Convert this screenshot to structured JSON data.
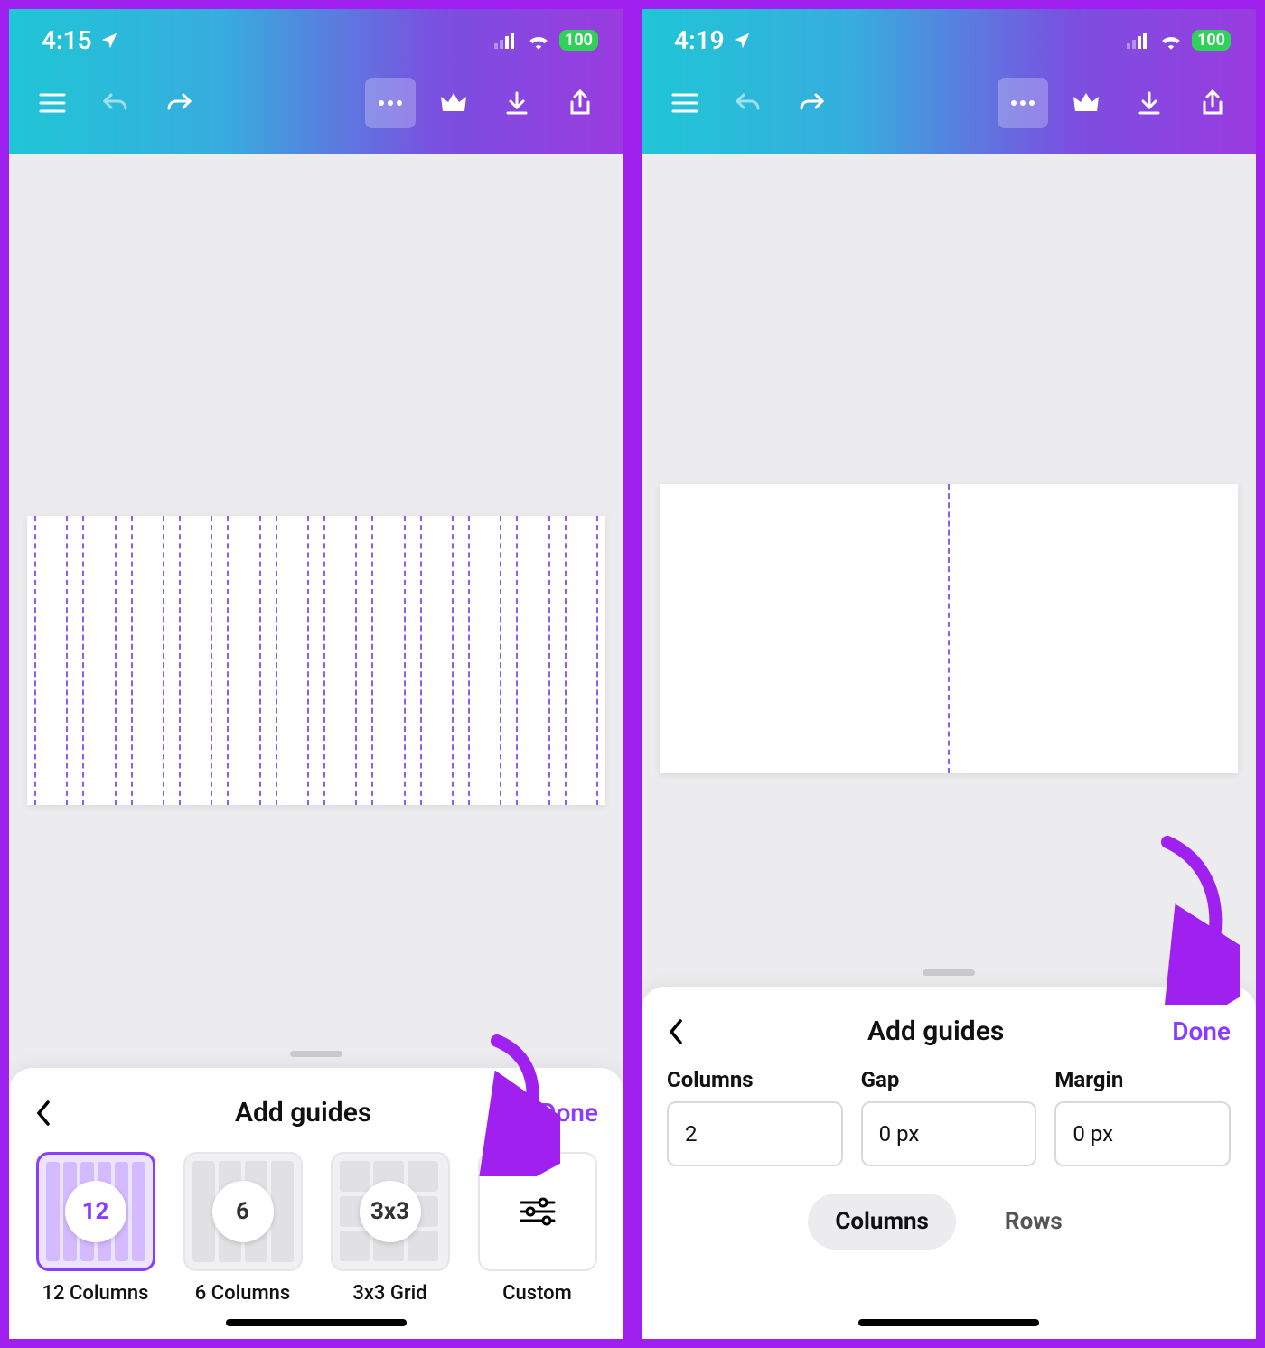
{
  "left": {
    "status": {
      "time": "4:15",
      "battery": "100"
    },
    "sheet": {
      "title": "Add guides",
      "done": "Done",
      "tiles": [
        {
          "badge": "12",
          "label": "12 Columns",
          "selected": true,
          "kind": "cols6"
        },
        {
          "badge": "6",
          "label": "6 Columns",
          "selected": false,
          "kind": "cols4"
        },
        {
          "badge": "3x3",
          "label": "3x3 Grid",
          "selected": false,
          "kind": "grid"
        },
        {
          "badge": "",
          "label": "Custom",
          "selected": false,
          "kind": "custom"
        }
      ]
    },
    "canvas": {
      "columns": 12
    }
  },
  "right": {
    "status": {
      "time": "4:19",
      "battery": "100"
    },
    "sheet": {
      "title": "Add guides",
      "done": "Done",
      "fields": {
        "columns": {
          "label": "Columns",
          "value": "2"
        },
        "gap": {
          "label": "Gap",
          "value": "0 px"
        },
        "margin": {
          "label": "Margin",
          "value": "0 px"
        }
      },
      "segments": {
        "columns": "Columns",
        "rows": "Rows",
        "active": "columns"
      }
    },
    "canvas": {
      "columns": 2
    }
  }
}
